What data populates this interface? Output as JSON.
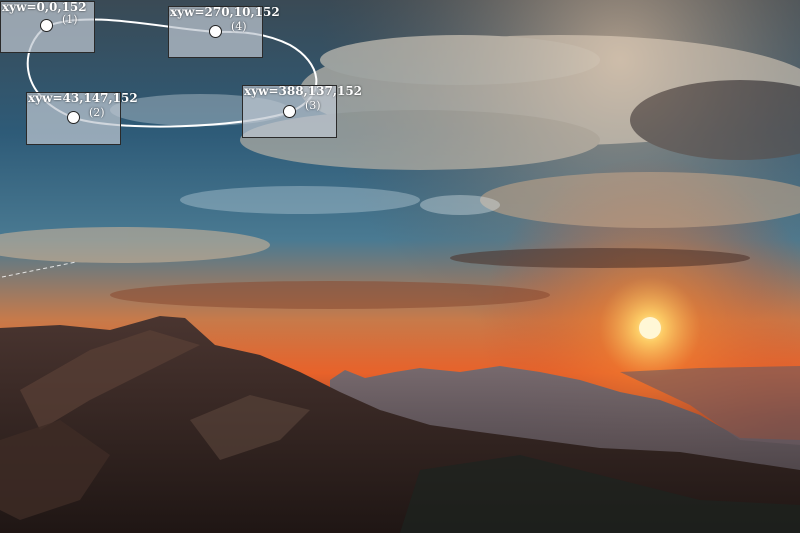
{
  "scene": {
    "description_icon": "mountain-sunset-photo-icon",
    "colors": {
      "sky_blue": "#2f5f80",
      "sun": "#ffd27a",
      "sunset_orange": "#e8602a",
      "mountain_dark": "#2b1f1c"
    }
  },
  "annotations": [
    {
      "coord": "xyw=0,0,152",
      "index": "(1)"
    },
    {
      "coord": "xyw=43,147,152",
      "index": "(2)"
    },
    {
      "coord": "xyw=388,137,152",
      "index": "(3)"
    },
    {
      "coord": "xyw=270,10,152",
      "index": "(4)"
    }
  ]
}
